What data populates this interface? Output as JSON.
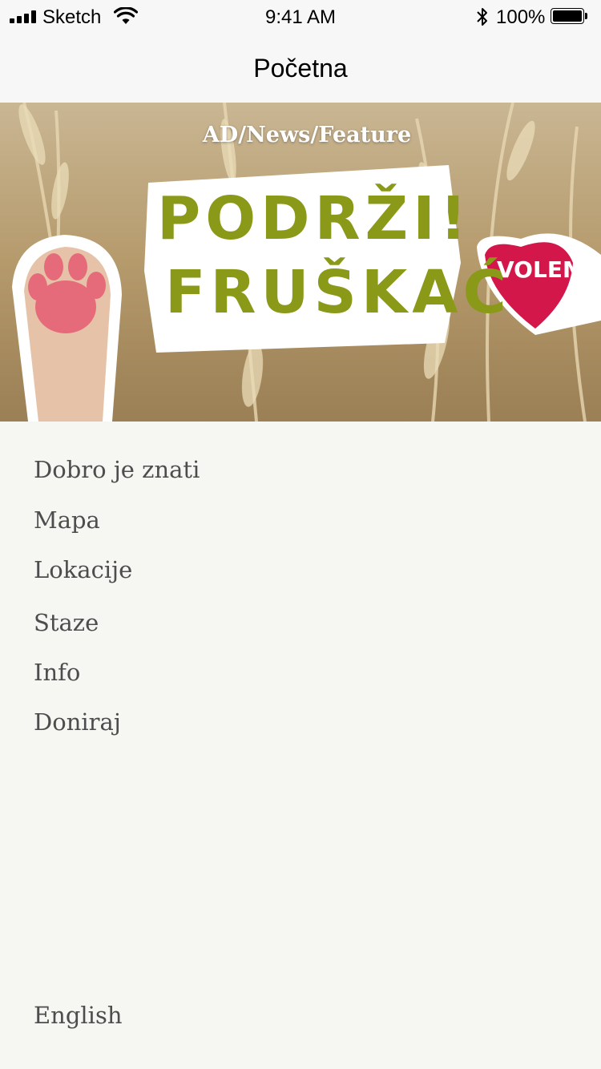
{
  "status_bar": {
    "carrier": "Sketch",
    "time": "9:41 AM",
    "battery_percent": "100%",
    "battery_level": 1.0,
    "icons": [
      "signal-icon",
      "wifi-icon",
      "bluetooth-icon",
      "battery-icon"
    ]
  },
  "nav": {
    "title": "Početna"
  },
  "banner": {
    "caption": "AD/News/Feature",
    "slogan_line1": "PODRŽI!",
    "slogan_line2": "FRUŠKAĆ",
    "heart_text": "VOLEM",
    "colors": {
      "slogan_green": "#8a9a18",
      "heart_red": "#d4174a",
      "paw_pink": "#e56b7a"
    }
  },
  "menu": {
    "items": [
      {
        "label": "Dobro je znati"
      },
      {
        "label": "Mapa"
      },
      {
        "label": "Lokacije"
      },
      {
        "label": "Staze"
      },
      {
        "label": "Info"
      },
      {
        "label": "Doniraj"
      }
    ]
  },
  "language_link": "English"
}
